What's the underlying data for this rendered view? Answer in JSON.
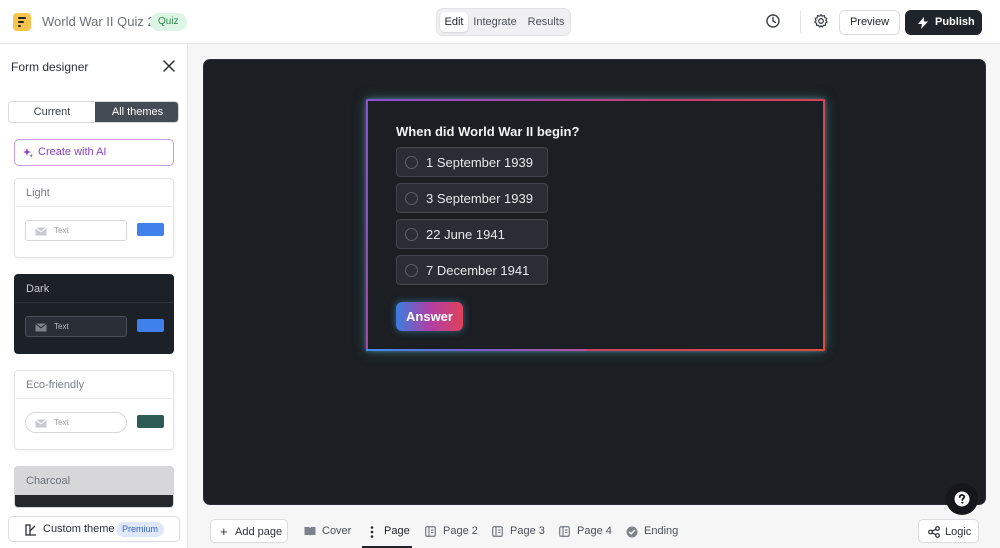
{
  "header": {
    "title": "World War II Quiz 2",
    "badge": "Quiz",
    "mode_tabs": [
      {
        "label": "Edit",
        "active": true
      },
      {
        "label": "Integrate",
        "active": false
      },
      {
        "label": "Results",
        "active": false
      }
    ],
    "preview_label": "Preview",
    "publish_label": "Publish",
    "icons": [
      "history-icon",
      "settings-gear-icon",
      "lightning-icon"
    ]
  },
  "sidebar": {
    "title": "Form designer",
    "segments": [
      {
        "label": "Current",
        "active": false
      },
      {
        "label": "All themes",
        "active": true
      }
    ],
    "ai_button": "Create with AI",
    "themes": [
      {
        "name": "Light",
        "field_text": "Text",
        "accent": "#3f80ea"
      },
      {
        "name": "Dark",
        "field_text": "Text",
        "accent": "#3f80ea"
      },
      {
        "name": "Eco-friendly",
        "field_text": "Text",
        "accent": "#2f5b57"
      },
      {
        "name": "Charcoal"
      }
    ],
    "custom_theme_label": "Custom theme",
    "premium_badge": "Premium"
  },
  "question": {
    "text": "When did World War II begin?",
    "options": [
      "1 September 1939",
      "3 September 1939",
      "22 June 1941",
      "7 December 1941"
    ],
    "answer_button": "Answer"
  },
  "bottom": {
    "add_page": "Add page",
    "pages": [
      {
        "label": "Cover",
        "icon": "book-icon",
        "active": false
      },
      {
        "label": "Page",
        "icon": "vertical-dots-icon",
        "active": true
      },
      {
        "label": "Page 2",
        "icon": "page-icon",
        "active": false
      },
      {
        "label": "Page 3",
        "icon": "page-icon",
        "active": false
      },
      {
        "label": "Page 4",
        "icon": "page-icon",
        "active": false
      },
      {
        "label": "Ending",
        "icon": "check-circle-icon",
        "active": false
      }
    ],
    "logic": "Logic"
  },
  "colors": {
    "publish_bg": "#1f242b",
    "canvas_bg": "#1b1e22",
    "quiz_badge_bg": "#dcf5e4",
    "ai_accent": "#8a3fc7"
  }
}
